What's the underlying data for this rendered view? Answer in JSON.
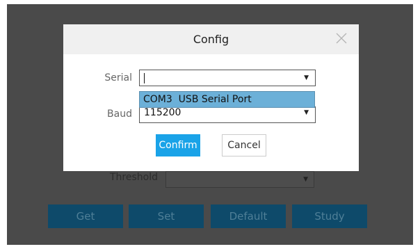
{
  "background": {
    "threshold_label": "Threshold",
    "buttons": [
      "Get",
      "Set",
      "Default",
      "Study"
    ]
  },
  "dialog": {
    "title": "Config",
    "serial_label": "Serial",
    "serial_value": "",
    "serial_options": [
      "COM3  USB Serial Port"
    ],
    "baud_label": "Baud",
    "baud_value": "115200",
    "confirm_label": "Confirm",
    "cancel_label": "Cancel"
  },
  "colors": {
    "accent": "#1aa3e8",
    "dropdown_highlight": "#6cb0d8",
    "app_background": "#4a4a4a",
    "background_button": "#0e4a6a"
  },
  "icons": {
    "close": "close-icon",
    "dropdown_arrow": "chevron-down-icon"
  }
}
